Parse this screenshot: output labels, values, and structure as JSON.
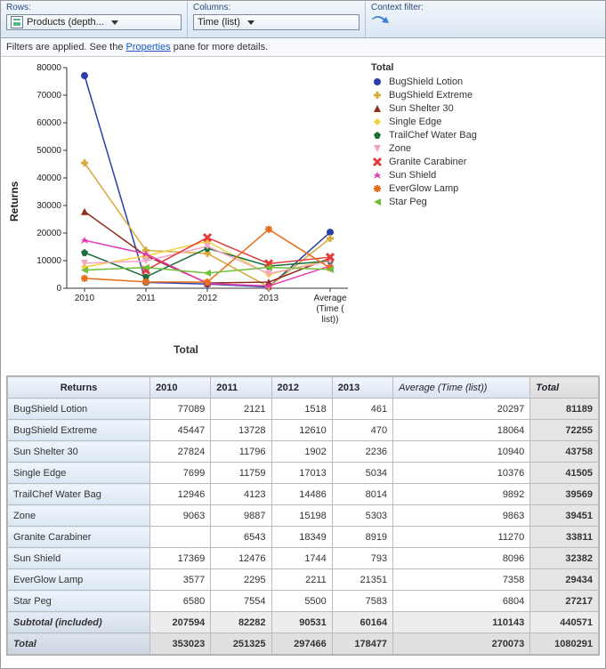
{
  "toolbar": {
    "rows_label": "Rows:",
    "rows_value": "Products (depth...",
    "cols_label": "Columns:",
    "cols_value": "Time (list)",
    "ctx_label": "Context filter:"
  },
  "filter_notice": {
    "prefix": "Filters are applied. See the ",
    "link": "Properties",
    "suffix": " pane for more details."
  },
  "chart_data": {
    "type": "line",
    "title": "Total",
    "ylabel": "Returns",
    "xlabel": "Total",
    "ylim": [
      0,
      80000
    ],
    "yticks": [
      0,
      10000,
      20000,
      30000,
      40000,
      50000,
      60000,
      70000,
      80000
    ],
    "categories": [
      "2010",
      "2011",
      "2012",
      "2013",
      "Average (Time (list))"
    ],
    "series": [
      {
        "name": "BugShield Lotion",
        "color": "#2a3ea8",
        "marker": "circle",
        "values": [
          77089,
          2121,
          1518,
          461,
          20297
        ]
      },
      {
        "name": "BugShield Extreme",
        "color": "#d9a93a",
        "marker": "plus",
        "values": [
          45447,
          13728,
          12610,
          470,
          18064
        ]
      },
      {
        "name": "Sun Shelter 30",
        "color": "#8f2d1c",
        "marker": "triangle",
        "values": [
          27824,
          11796,
          1902,
          2236,
          10940
        ]
      },
      {
        "name": "Single Edge",
        "color": "#f1d23a",
        "marker": "diamond",
        "values": [
          7699,
          11759,
          17013,
          5034,
          10376
        ]
      },
      {
        "name": "TrailChef Water Bag",
        "color": "#1c6d3a",
        "marker": "pentagon",
        "values": [
          12946,
          4123,
          14486,
          8014,
          9892
        ]
      },
      {
        "name": "Zone",
        "color": "#f2a6c2",
        "marker": "tri-down",
        "values": [
          9063,
          9887,
          15198,
          5303,
          9863
        ]
      },
      {
        "name": "Granite Carabiner",
        "color": "#e23b3b",
        "marker": "x",
        "values": [
          null,
          6543,
          18349,
          8919,
          11270
        ]
      },
      {
        "name": "Sun Shield",
        "color": "#e23bb3",
        "marker": "star",
        "values": [
          17369,
          12476,
          1744,
          793,
          8096
        ]
      },
      {
        "name": "EverGlow Lamp",
        "color": "#e86f1a",
        "marker": "cross",
        "values": [
          3577,
          2295,
          2211,
          21351,
          7358
        ]
      },
      {
        "name": "Star Peg",
        "color": "#6fbf3a",
        "marker": "tri-left",
        "values": [
          6580,
          7554,
          5500,
          7583,
          6804
        ]
      }
    ]
  },
  "table": {
    "row_header": "Returns",
    "columns": [
      "2010",
      "2011",
      "2012",
      "2013"
    ],
    "avg_col": "Average (Time (list))",
    "total_col": "Total",
    "rows": [
      {
        "label": "BugShield Lotion",
        "cells": [
          77089,
          2121,
          1518,
          461
        ],
        "avg": 20297,
        "total": 81189
      },
      {
        "label": "BugShield Extreme",
        "cells": [
          45447,
          13728,
          12610,
          470
        ],
        "avg": 18064,
        "total": 72255
      },
      {
        "label": "Sun Shelter 30",
        "cells": [
          27824,
          11796,
          1902,
          2236
        ],
        "avg": 10940,
        "total": 43758
      },
      {
        "label": "Single Edge",
        "cells": [
          7699,
          11759,
          17013,
          5034
        ],
        "avg": 10376,
        "total": 41505
      },
      {
        "label": "TrailChef Water Bag",
        "cells": [
          12946,
          4123,
          14486,
          8014
        ],
        "avg": 9892,
        "total": 39569
      },
      {
        "label": "Zone",
        "cells": [
          9063,
          9887,
          15198,
          5303
        ],
        "avg": 9863,
        "total": 39451
      },
      {
        "label": "Granite Carabiner",
        "cells": [
          null,
          6543,
          18349,
          8919
        ],
        "avg": 11270,
        "total": 33811
      },
      {
        "label": "Sun Shield",
        "cells": [
          17369,
          12476,
          1744,
          793
        ],
        "avg": 8096,
        "total": 32382
      },
      {
        "label": "EverGlow Lamp",
        "cells": [
          3577,
          2295,
          2211,
          21351
        ],
        "avg": 7358,
        "total": 29434
      },
      {
        "label": "Star Peg",
        "cells": [
          6580,
          7554,
          5500,
          7583
        ],
        "avg": 6804,
        "total": 27217
      }
    ],
    "subtotal": {
      "label": "Subtotal (included)",
      "cells": [
        207594,
        82282,
        90531,
        60164
      ],
      "avg": 110143,
      "total": 440571
    },
    "grand": {
      "label": "Total",
      "cells": [
        353023,
        251325,
        297466,
        178477
      ],
      "avg": 270073,
      "total": 1080291
    }
  }
}
